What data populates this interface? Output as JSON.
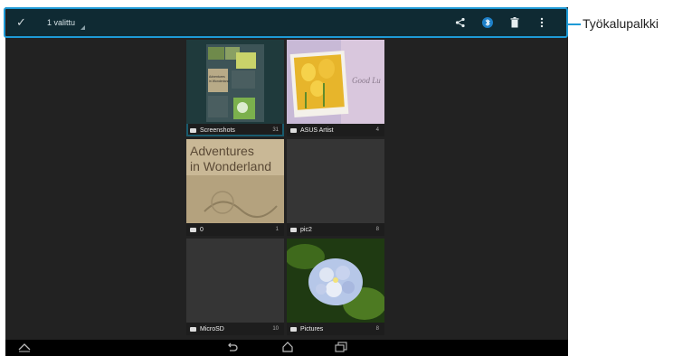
{
  "toolbar": {
    "selection_count": "1 valittu",
    "callout_label": "Työkalupalkki"
  },
  "albums": [
    {
      "name": "Screenshots",
      "count": "31"
    },
    {
      "name": "ASUS Artist",
      "count": "4"
    },
    {
      "name": "0",
      "count": "1",
      "thumb_text_1": "Adventures",
      "thumb_text_2": "in Wonderland"
    },
    {
      "name": "pic2",
      "count": "8"
    },
    {
      "name": "MicroSD",
      "count": "10"
    },
    {
      "name": "Pictures",
      "count": "8"
    }
  ],
  "thumb_screenshots": {
    "text_1": "Adventures",
    "text_2": "in Wonderland"
  },
  "thumb_asus": {
    "text": "Good Lu"
  },
  "colors": {
    "accent": "#1e9ad6",
    "toolbar_bg": "#0f2a33",
    "screen_bg": "#222222",
    "tile_bg": "#353535"
  },
  "icons": [
    "check-icon",
    "share-icon",
    "bluetooth-icon",
    "trash-icon",
    "overflow-menu-icon",
    "folder-icon",
    "recent-apps-icon",
    "back-icon",
    "home-icon",
    "collapse-icon"
  ]
}
